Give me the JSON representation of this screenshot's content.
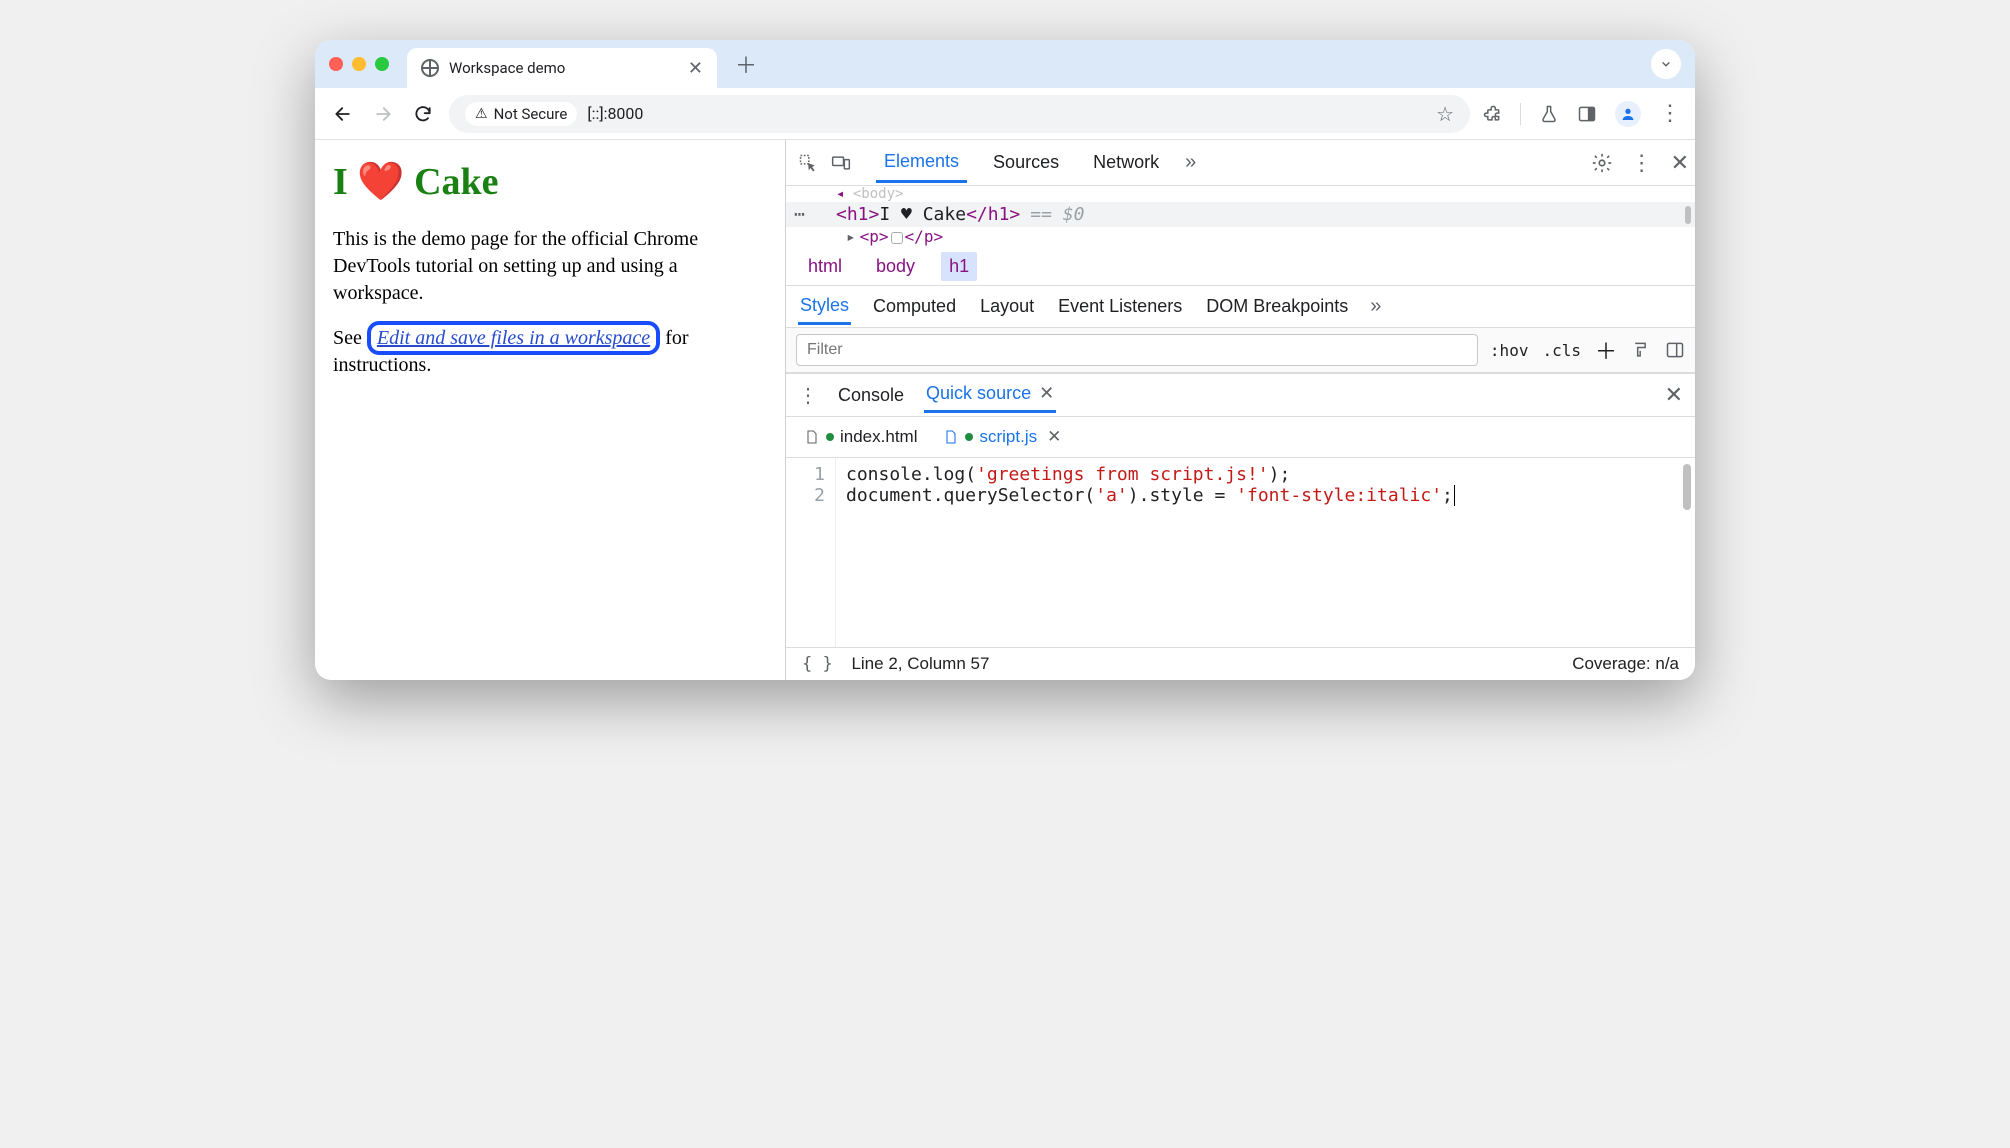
{
  "tab": {
    "title": "Workspace demo"
  },
  "addr": {
    "security": "Not Secure",
    "url": "[::]:8000"
  },
  "page": {
    "h1": "I ❤️ Cake",
    "p1": "This is the demo page for the official Chrome DevTools tutorial on setting up and using a workspace.",
    "p2_pre": "See ",
    "link": "Edit and save files in a workspace",
    "p2_post": " for instructions."
  },
  "devtools": {
    "tabs": {
      "elements": "Elements",
      "sources": "Sources",
      "network": "Network"
    },
    "dom_prev": "<body>",
    "dom": {
      "open": "<h1>",
      "text": "I ♥ Cake",
      "close": "</h1>",
      "eq": "== $0"
    },
    "dom_next": "<p>...</p>",
    "breadcrumb": [
      "html",
      "body",
      "h1"
    ],
    "styles_tabs": {
      "styles": "Styles",
      "computed": "Computed",
      "layout": "Layout",
      "listeners": "Event Listeners",
      "dom_bp": "DOM Breakpoints"
    },
    "filter_placeholder": "Filter",
    "filter_tools": {
      "hov": ":hov",
      "cls": ".cls"
    },
    "drawer_tabs": {
      "console": "Console",
      "quick": "Quick source"
    },
    "file_tabs": {
      "index": "index.html",
      "script": "script.js"
    },
    "code": {
      "l1_a": "console.log(",
      "l1_str": "'greetings from script.js!'",
      "l1_b": ");",
      "l2_a": "document.querySelector(",
      "l2_s1": "'a'",
      "l2_b": ").style = ",
      "l2_s2": "'font-style:italic'",
      "l2_c": ";"
    },
    "gutter": {
      "l1": "1",
      "l2": "2"
    },
    "status": {
      "pos": "Line 2, Column 57",
      "coverage": "Coverage: n/a"
    }
  }
}
